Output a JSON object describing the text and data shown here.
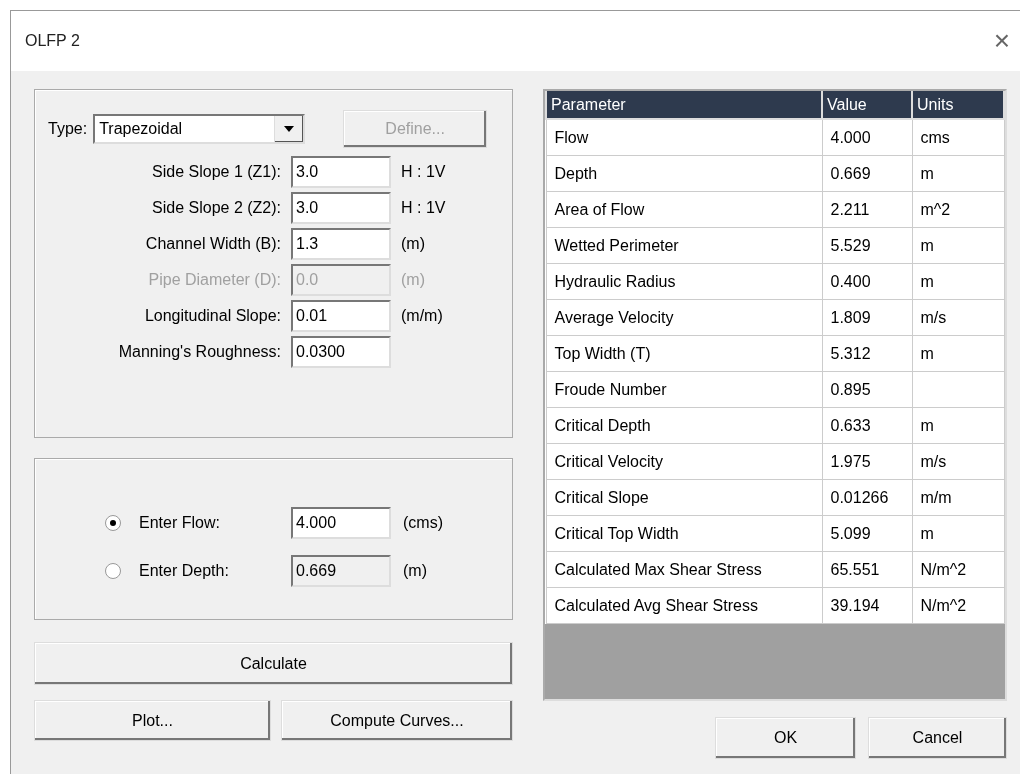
{
  "window": {
    "title": "OLFP 2",
    "close": "×"
  },
  "channel": {
    "type": {
      "label": "Type:",
      "value": "Trapezoidal"
    },
    "define_button": {
      "label": "Define...",
      "disabled": true
    },
    "fields": [
      {
        "label": "Side Slope 1 (Z1):",
        "value": "3.0",
        "unit": "H : 1V",
        "disabled": false
      },
      {
        "label": "Side Slope 2 (Z2):",
        "value": "3.0",
        "unit": "H : 1V",
        "disabled": false
      },
      {
        "label": "Channel Width (B):",
        "value": "1.3",
        "unit": "(m)",
        "disabled": false
      },
      {
        "label": "Pipe Diameter (D):",
        "value": "0.0",
        "unit": "(m)",
        "disabled": true
      },
      {
        "label": "Longitudinal Slope:",
        "value": "0.01",
        "unit": "(m/m)",
        "disabled": false
      },
      {
        "label": "Manning's Roughness:",
        "value": "0.0300",
        "disabled": false
      }
    ]
  },
  "input_mode": {
    "options": [
      {
        "label": "Enter Flow:",
        "value": "4.000",
        "unit": "(cms)",
        "selected": true
      },
      {
        "label": "Enter Depth:",
        "value": "0.669",
        "unit": "(m)",
        "selected": false
      }
    ]
  },
  "calculate_button": "Calculate",
  "action_buttons": [
    "Plot...",
    "Compute Curves..."
  ],
  "table": {
    "columns": [
      "Parameter",
      "Value",
      "Units"
    ],
    "rows": [
      [
        "Flow",
        "4.000",
        "cms"
      ],
      [
        "Depth",
        "0.669",
        "m"
      ],
      [
        "Area of Flow",
        "2.211",
        "m^2"
      ],
      [
        "Wetted Perimeter",
        "5.529",
        "m"
      ],
      [
        "Hydraulic Radius",
        "0.400",
        "m"
      ],
      [
        "Average Velocity",
        "1.809",
        "m/s"
      ],
      [
        "Top Width (T)",
        "5.312",
        "m"
      ],
      [
        "Froude Number",
        "0.895",
        ""
      ],
      [
        "Critical Depth",
        "0.633",
        "m"
      ],
      [
        "Critical Velocity",
        "1.975",
        "m/s"
      ],
      [
        "Critical Slope",
        "0.01266",
        "m/m"
      ],
      [
        "Critical Top Width",
        "5.099",
        "m"
      ],
      [
        "Calculated Max Shear Stress",
        "65.551",
        "N/m^2"
      ],
      [
        "Calculated Avg Shear Stress",
        "39.194",
        "N/m^2"
      ]
    ]
  },
  "dialog_buttons": [
    "OK",
    "Cancel"
  ]
}
